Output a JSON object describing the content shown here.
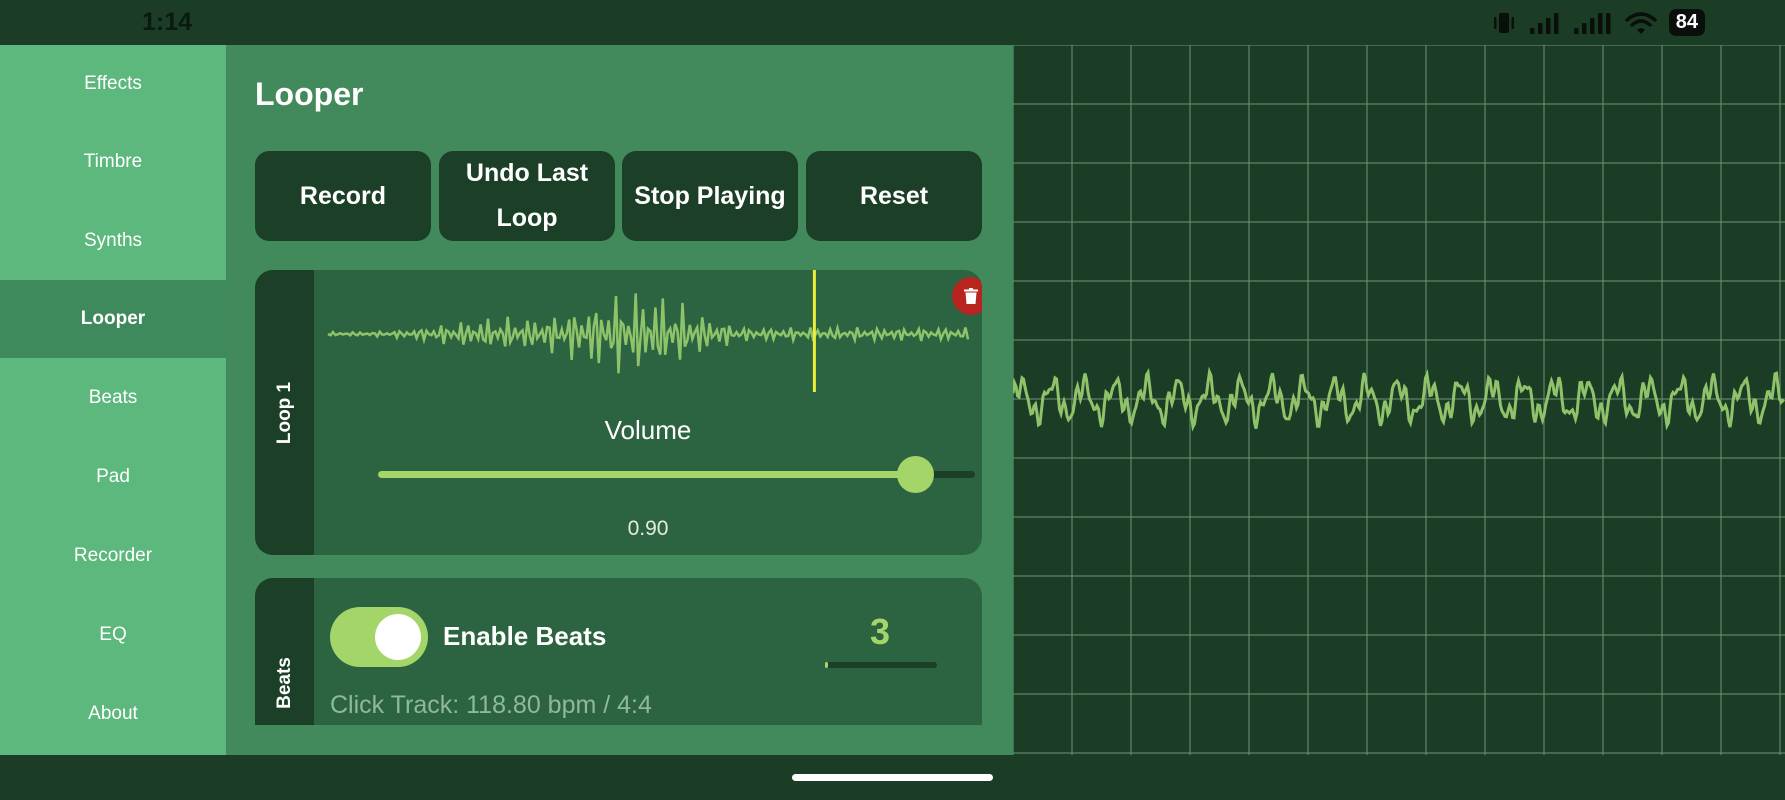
{
  "status_bar": {
    "time": "1:14",
    "battery": "84",
    "icons": [
      "vibrate-icon",
      "cell-signal-icon",
      "cell-signal-icon",
      "wifi-icon",
      "battery-icon"
    ]
  },
  "sidebar": {
    "items": [
      {
        "label": "Effects"
      },
      {
        "label": "Timbre"
      },
      {
        "label": "Synths"
      },
      {
        "label": "Looper",
        "active": true
      },
      {
        "label": "Beats"
      },
      {
        "label": "Pad"
      },
      {
        "label": "Recorder"
      },
      {
        "label": "EQ"
      },
      {
        "label": "About"
      }
    ]
  },
  "main": {
    "title": "Looper",
    "buttons": [
      {
        "label": "Record"
      },
      {
        "label": "Undo Last Loop"
      },
      {
        "label": "Stop Playing"
      },
      {
        "label": "Reset"
      }
    ],
    "loop": {
      "name": "Loop 1",
      "delete_icon": "trash-icon",
      "playhead_position": 0.76,
      "volume_label": "Volume",
      "volume_value": "0.90",
      "volume_level": 0.9
    },
    "beats": {
      "tab_label": "Beats",
      "toggle_on": true,
      "enable_label": "Enable Beats",
      "beat_count": "3",
      "beat_progress": 0.03,
      "click_track": "Click Track: 118.80 bpm / 4:4"
    }
  },
  "colors": {
    "background": "#1c3d25",
    "sidebar": "#5db87d",
    "sidebar_active": "#3f8a5c",
    "panel": "#428a5c",
    "card": "#2c6442",
    "dark": "#1b3f27",
    "accent": "#a3d568",
    "playhead": "#e8ee3a",
    "delete": "#b8241f"
  }
}
